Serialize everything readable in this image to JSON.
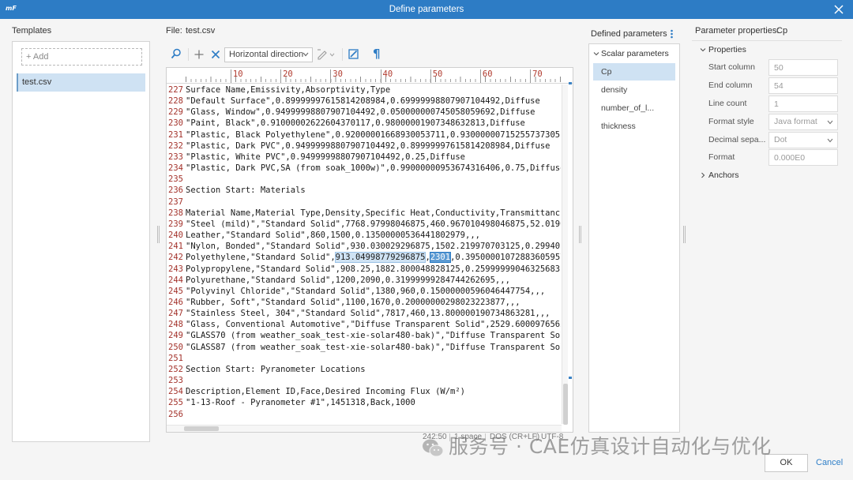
{
  "window": {
    "app_icon_text": "mF",
    "title": "Define parameters"
  },
  "templates": {
    "heading": "Templates",
    "add_icon": "+",
    "add_label": "Add",
    "items": [
      {
        "label": "test.csv",
        "selected": true
      }
    ]
  },
  "file": {
    "label": "File:",
    "name": "test.csv"
  },
  "toolbar": {
    "direction": "Horizontal direction",
    "pilcrow": "¶",
    "icons": [
      "search-icon",
      "add-icon",
      "remove-icon",
      "edit-dropdown-icon",
      "edit-square-icon",
      "pilcrow-icon"
    ]
  },
  "ruler": {
    "ticks": [
      "10",
      "20",
      "30",
      "40",
      "50",
      "60",
      "70"
    ]
  },
  "editor": {
    "lines": [
      {
        "n": "227",
        "text": "Surface Name,Emissivity,Absorptivity,Type"
      },
      {
        "n": "228",
        "text": "\"Default Surface\",0.89999997615814208984,0.69999998807907104492,Diffuse"
      },
      {
        "n": "229",
        "text": "\"Glass, Window\",0.94999998807907104492,0.050000000745058059692,Diffuse"
      },
      {
        "n": "230",
        "text": "\"Paint, Black\",0.91000002622604370117,0.98000001907348632813,Diffuse"
      },
      {
        "n": "231",
        "text": "\"Plastic, Black Polyethylene\",0.92000001668930053711,0.93000000715255737305"
      },
      {
        "n": "232",
        "text": "\"Plastic, Dark PVC\",0.94999998807907104492,0.89999997615814208984,Diffuse"
      },
      {
        "n": "233",
        "text": "\"Plastic, White PVC\",0.94999998807907104492,0.25,Diffuse"
      },
      {
        "n": "234",
        "text": "\"Plastic, Dark PVC,SA (from soak_1000w)\",0.99000000953674316406,0.75,Diffuse"
      },
      {
        "n": "235",
        "text": ""
      },
      {
        "n": "236",
        "text": "Section Start: Materials"
      },
      {
        "n": "237",
        "text": ""
      },
      {
        "n": "238",
        "text": "Material Name,Material Type,Density,Specific Heat,Conductivity,Transmittanc"
      },
      {
        "n": "239",
        "text": "\"Steel (mild)\",\"Standard Solid\",7768.97998046875,460.967010498046875,52.0190"
      },
      {
        "n": "240",
        "text": "Leather,\"Standard Solid\",860,1500,0.13500000536441802979,,,"
      },
      {
        "n": "241",
        "text": "\"Nylon, Bonded\",\"Standard Solid\",930.030029296875,1502.219970703125,0.29940"
      },
      {
        "n": "242",
        "prefix": "Polyethylene,\"Standard Solid\",",
        "match": "913.04998779296875",
        "sep": ",",
        "selected": "2301",
        "suffix": ",0.39500001072883605957"
      },
      {
        "n": "243",
        "text": "Polypropylene,\"Standard Solid\",908.25,1882.800048828125,0.25999999046325683"
      },
      {
        "n": "244",
        "text": "Polyurethane,\"Standard Solid\",1200,2090,0.31999999284744262695,,,"
      },
      {
        "n": "245",
        "text": "\"Polyvinyl Chloride\",\"Standard Solid\",1380,960,0.15000000596046447754,,,"
      },
      {
        "n": "246",
        "text": "\"Rubber, Soft\",\"Standard Solid\",1100,1670,0.20000000298023223877,,,"
      },
      {
        "n": "247",
        "text": "\"Stainless Steel, 304\",\"Standard Solid\",7817,460,13.800000190734863281,,,"
      },
      {
        "n": "248",
        "text": "\"Glass, Conventional Automotive\",\"Diffuse Transparent Solid\",2529.6000976562"
      },
      {
        "n": "249",
        "text": "\"GLASS70 (from weather_soak_test-xie-solar480-bak)\",\"Diffuse Transparent Sol"
      },
      {
        "n": "250",
        "text": "\"GLASS87 (from weather_soak_test-xie-solar480-bak)\",\"Diffuse Transparent Sol"
      },
      {
        "n": "251",
        "text": ""
      },
      {
        "n": "252",
        "text": "Section Start: Pyranometer Locations"
      },
      {
        "n": "253",
        "text": ""
      },
      {
        "n": "254",
        "text": "Description,Element ID,Face,Desired Incoming Flux (W/m²)"
      },
      {
        "n": "255",
        "text": "\"1-13-Roof - Pyranometer #1\",1451318,Back,1000"
      },
      {
        "n": "256",
        "text": ""
      }
    ]
  },
  "status": {
    "position": "242:50",
    "indent": "1 space",
    "line_ending": "DOS (CR+LF)",
    "encoding": "UTF-8"
  },
  "defined_parameters": {
    "heading": "Defined parameters",
    "group": "Scalar parameters",
    "items": [
      "Cp",
      "density",
      "number_of_l...",
      "thickness"
    ],
    "selected_index": 0
  },
  "properties": {
    "heading": "Parameter properties:",
    "param": "Cp",
    "section": "Properties",
    "fields": [
      {
        "label": "Start column",
        "value": "50"
      },
      {
        "label": "End column",
        "value": "54"
      },
      {
        "label": "Line count",
        "value": "1"
      },
      {
        "label": "Format style",
        "value": "Java format"
      },
      {
        "label": "Decimal sepa...",
        "value": "Dot"
      },
      {
        "label": "Format",
        "value": "0.000E0"
      }
    ],
    "anchors": "Anchors"
  },
  "buttons": {
    "ok": "OK",
    "cancel": "Cancel"
  },
  "watermark": "服务号 · CAE仿真设计自动化与优化",
  "colors": {
    "title_bar": "#2d7cc5",
    "accent": "#2f7fc8",
    "selection_bg": "#cfe2f3",
    "line_number": "#a3322b",
    "text_selection": "#5d9bd3"
  }
}
